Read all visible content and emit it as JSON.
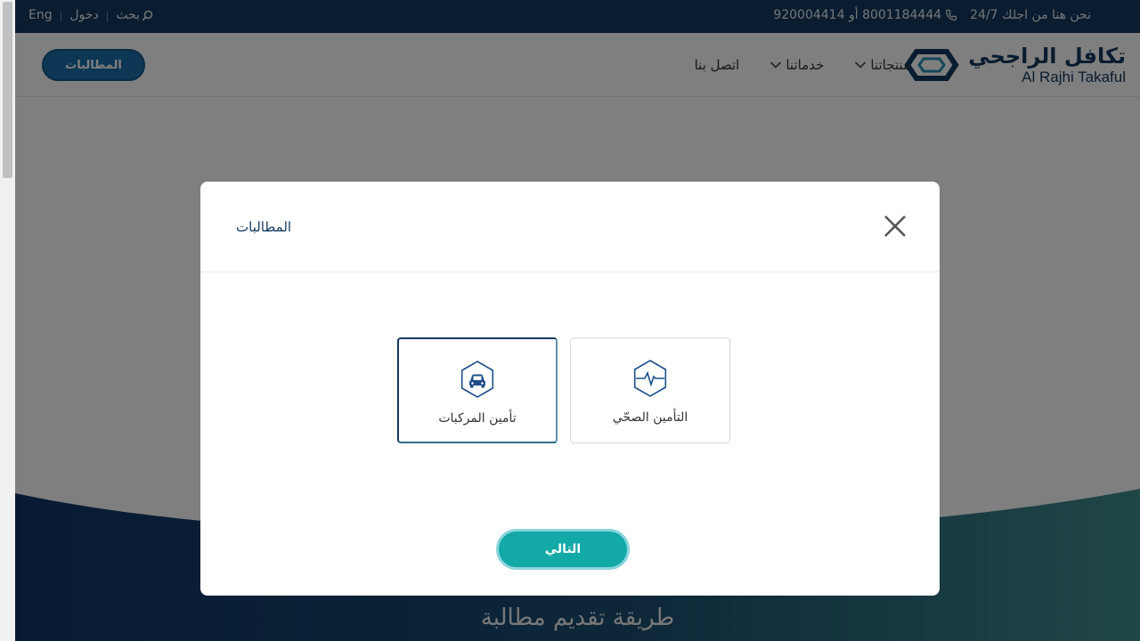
{
  "topbar": {
    "lang": "Eng",
    "login": "دخول",
    "search": "بحث",
    "phone": "8001184444 أو 920004414",
    "support": "نحن هنا من اجلك 24/7"
  },
  "header": {
    "logo_ar": "تكافل الراجحي",
    "logo_en": "Al Rajhi Takaful",
    "nav": {
      "products": "منتجاتنا",
      "services": "خدماتنا",
      "contact": "اتصل بنا"
    },
    "claims_button": "المطالبات"
  },
  "hero": {
    "title": "طريقة تقديم مطالبة"
  },
  "modal": {
    "title": "المطالبات",
    "options": {
      "motor": "تأمين المركبات",
      "health": "التأمين الصحّي"
    },
    "selected": "motor",
    "next_button": "التالي"
  },
  "colors": {
    "brand_navy": "#14385f",
    "brand_teal": "#12a9a6",
    "claims_blue": "#1a6fa8"
  },
  "icons": [
    "search-icon",
    "phone-icon",
    "chevron-down-icon",
    "close-icon",
    "car-icon",
    "heartbeat-icon",
    "logo-icon"
  ]
}
